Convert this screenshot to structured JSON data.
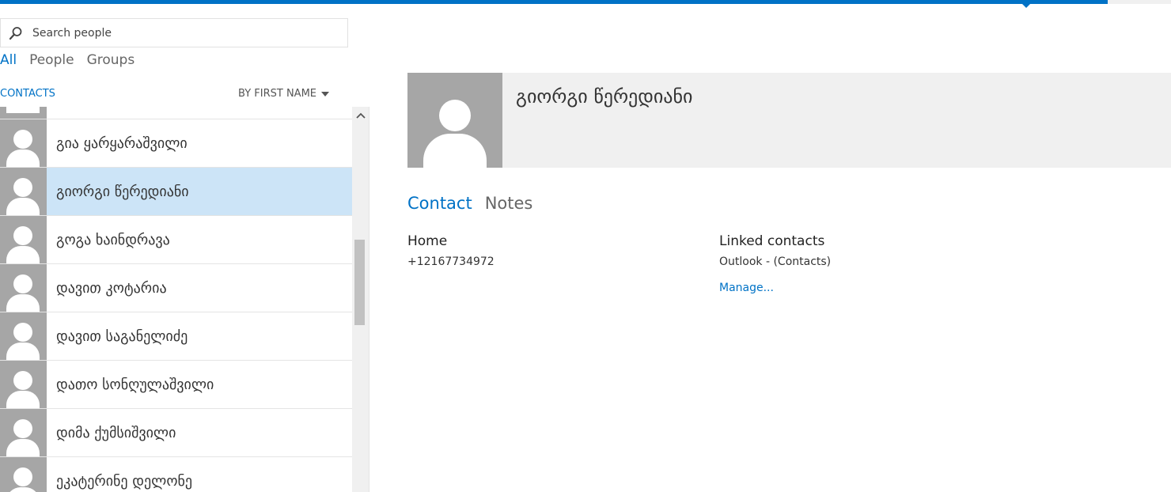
{
  "colors": {
    "accent": "#0072c6",
    "selected_row": "#cce4f7",
    "avatar_bg": "#a6a6a6"
  },
  "search": {
    "placeholder": "Search people",
    "icon": "search-icon"
  },
  "filters": [
    {
      "label": "All",
      "active": true
    },
    {
      "label": "People",
      "active": false
    },
    {
      "label": "Groups",
      "active": false
    }
  ],
  "list_header": {
    "section_label": "CONTACTS",
    "sort_label": "BY FIRST NAME"
  },
  "contacts": [
    {
      "name": "გია ყარყარაშვილი",
      "selected": false
    },
    {
      "name": "გიორგი წერედიანი",
      "selected": true
    },
    {
      "name": "გოგა ხაინდრავა",
      "selected": false
    },
    {
      "name": "დავით კოტარია",
      "selected": false
    },
    {
      "name": "დავით საგანელიძე",
      "selected": false
    },
    {
      "name": "დათო სონღულაშვილი",
      "selected": false
    },
    {
      "name": "დიმა ქუმსიშვილი",
      "selected": false
    },
    {
      "name": "ეკატერინე დელონე",
      "selected": false
    }
  ],
  "detail": {
    "name": "გიორგი წერედიანი",
    "tabs": [
      {
        "label": "Contact",
        "active": true
      },
      {
        "label": "Notes",
        "active": false
      }
    ],
    "home_label": "Home",
    "home_phone": "+12167734972",
    "linked_label": "Linked contacts",
    "linked_source": "Outlook - (Contacts)",
    "manage_label": "Manage..."
  }
}
